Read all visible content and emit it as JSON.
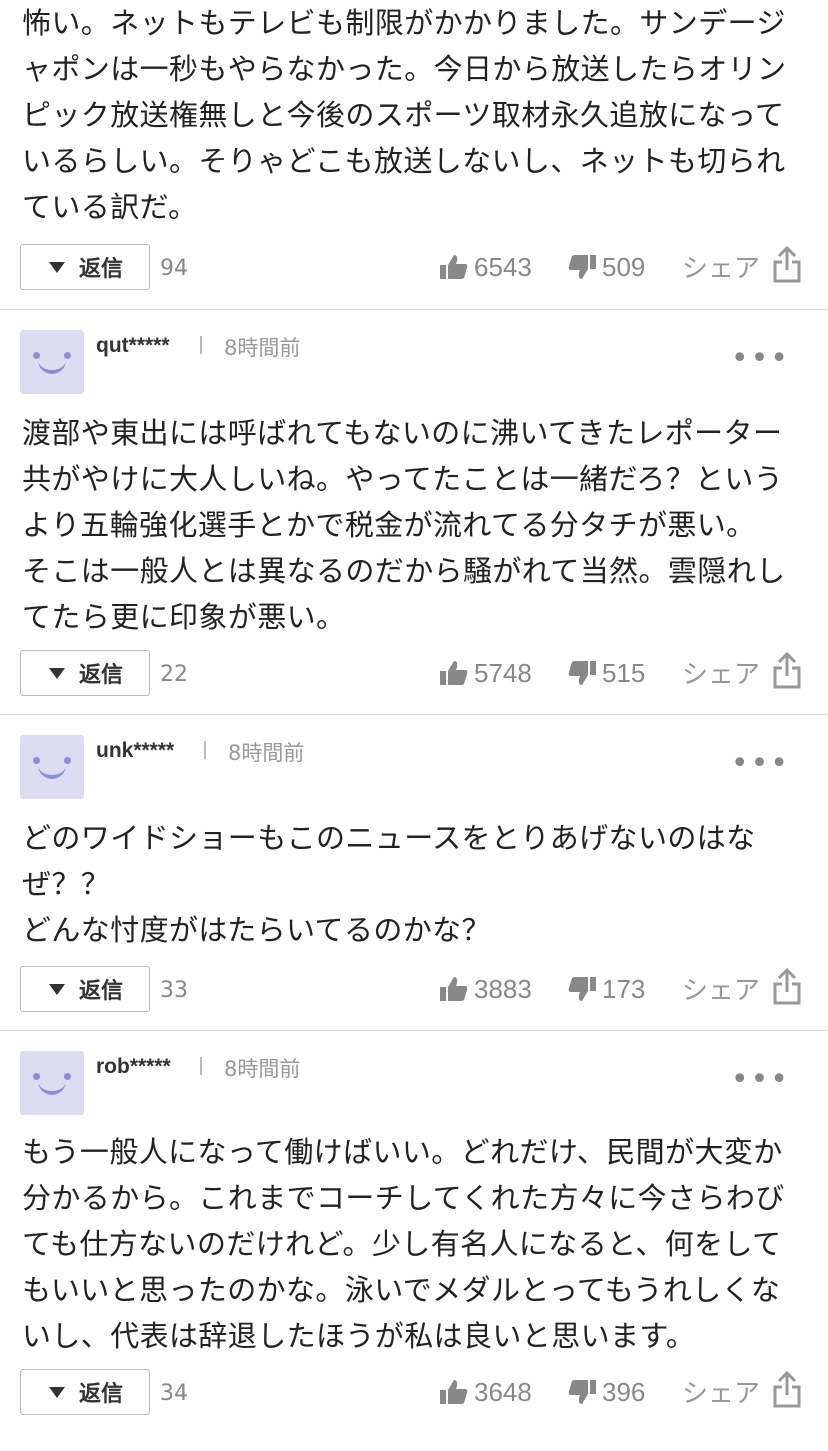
{
  "reply_label": "返信",
  "share_label": "シェア",
  "colors": {
    "avatar_bg": "#dcdcf2",
    "avatar_face": "#8d8dd4",
    "divider": "#dddddd",
    "muted": "#888888"
  },
  "comments": [
    {
      "body": "怖い。ネットもテレビも制限がかかりました。サンデージャポンは一秒もやらなかった。今日から放送したらオリンピック放送権無しと今後のスポーツ取材永久追放になっているらしい。そりゃどこも放送しないし、ネットも切られている訳だ。",
      "replies": "94",
      "likes": "6543",
      "dislikes": "509"
    },
    {
      "user": "qut*****",
      "time": "8時間前",
      "body": "渡部や東出には呼ばれてもないのに沸いてきたレポーター共がやけに大人しいね。やってたことは一緒だろ？というより五輪強化選手とかで税金が流れてる分タチが悪い。\nそこは一般人とは異なるのだから騒がれて当然。雲隠れしてたら更に印象が悪い。",
      "replies": "22",
      "likes": "5748",
      "dislikes": "515"
    },
    {
      "user": "unk*****",
      "time": "8時間前",
      "body": "どのワイドショーもこのニュースをとりあげないのはなぜ？？\nどんな忖度がはたらいてるのかな？",
      "replies": "33",
      "likes": "3883",
      "dislikes": "173"
    },
    {
      "user": "rob*****",
      "time": "8時間前",
      "body": "もう一般人になって働けばいい。どれだけ、民間が大変か分かるから。これまでコーチしてくれた方々に今さらわびても仕方ないのだけれど。少し有名人になると、何をしてもいいと思ったのかな。泳いでメダルとってもうれしくないし、代表は辞退したほうが私は良いと思います。",
      "replies": "34",
      "likes": "3648",
      "dislikes": "396"
    }
  ]
}
